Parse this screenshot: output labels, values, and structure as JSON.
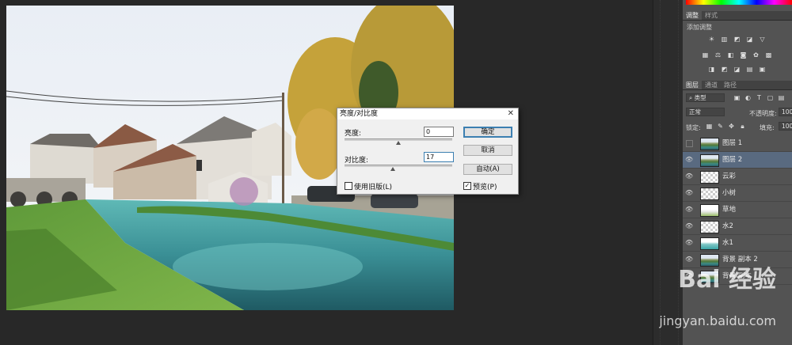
{
  "dialog": {
    "title": "亮度/对比度",
    "close": "✕",
    "brightness_label": "亮度:",
    "brightness_value": "0",
    "contrast_label": "对比度:",
    "contrast_value": "17",
    "ok": "确定",
    "cancel": "取消",
    "auto": "自动(A)",
    "legacy_label": "使用旧版(L)",
    "legacy_checked": false,
    "preview_label": "预览(P)",
    "preview_checked": true
  },
  "adjustments_panel": {
    "tabs": [
      "调整",
      "样式"
    ],
    "add_adjustment_label": "添加调整"
  },
  "layers_panel": {
    "tabs": [
      "图层",
      "通道",
      "路径"
    ],
    "kind_filter": "类型",
    "blend_mode": "正常",
    "opacity_label": "不透明度:",
    "opacity_value": "100%",
    "lock_label": "锁定:",
    "fill_label": "填充:",
    "fill_value": "100%",
    "layers": [
      {
        "name": "图层 1",
        "visible": false,
        "thumb": "photo",
        "selected": false
      },
      {
        "name": "图层 2",
        "visible": true,
        "thumb": "photo",
        "selected": true
      },
      {
        "name": "云彩",
        "visible": true,
        "thumb": "checker",
        "selected": false
      },
      {
        "name": "小树",
        "visible": true,
        "thumb": "checker",
        "selected": false
      },
      {
        "name": "草地",
        "visible": true,
        "thumb": "grass",
        "selected": false
      },
      {
        "name": "水2",
        "visible": true,
        "thumb": "checker",
        "selected": false
      },
      {
        "name": "水1",
        "visible": true,
        "thumb": "water",
        "selected": false
      },
      {
        "name": "背景 副本 2",
        "visible": true,
        "thumb": "photo",
        "selected": false
      },
      {
        "name": "背景 副本",
        "visible": true,
        "thumb": "photo",
        "selected": false
      }
    ]
  },
  "watermark": {
    "brand": "Bai 经验",
    "url": "jingyan.baidu.com"
  }
}
